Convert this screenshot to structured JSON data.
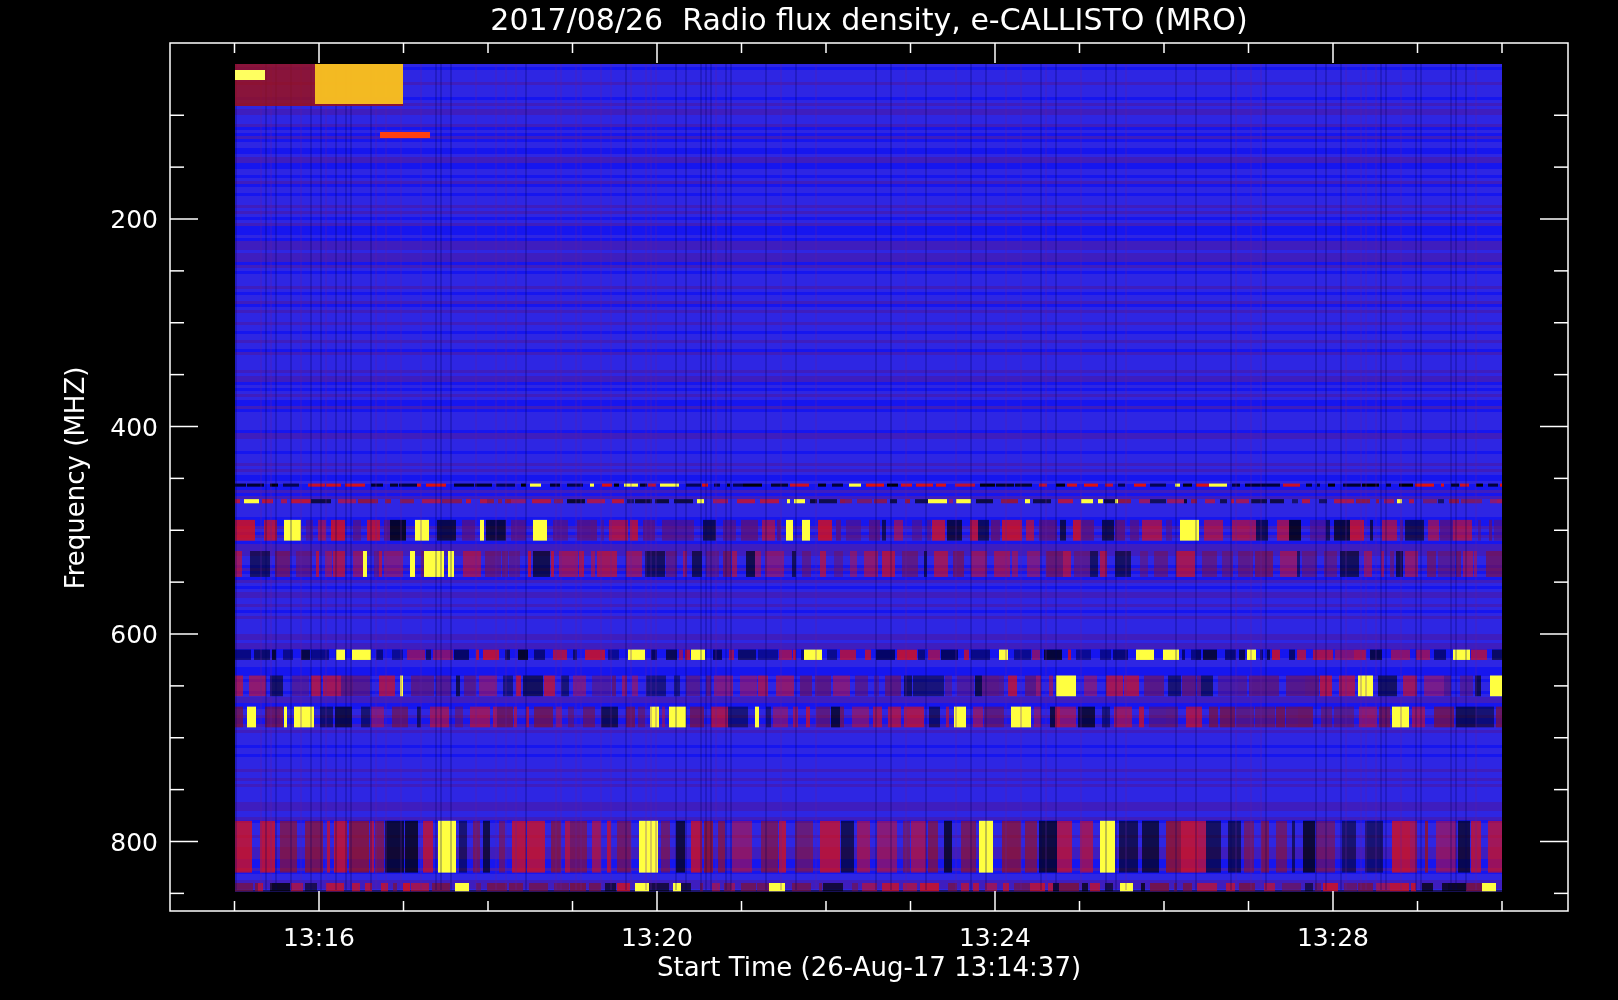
{
  "plot": {
    "title": "2017/08/26  Radio flux density, e-CALLISTO (MRO)",
    "y_axis": {
      "label": "Frequency (MHZ)",
      "ticks": [
        "200",
        "400",
        "600",
        "800"
      ]
    },
    "x_axis": {
      "label": "Start Time (26-Aug-17 13:14:37)",
      "ticks": [
        "13:16",
        "13:20",
        "13:24",
        "13:28"
      ]
    }
  }
}
